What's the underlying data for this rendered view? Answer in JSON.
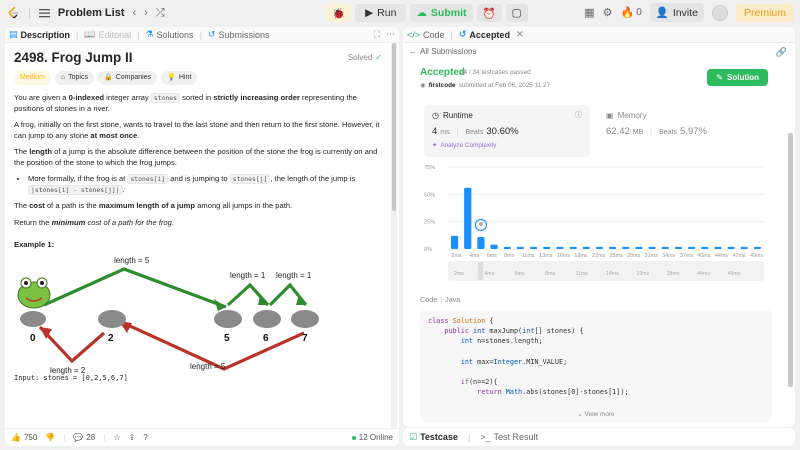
{
  "topbar": {
    "title": "Problem List",
    "run": "Run",
    "submit": "Submit",
    "likes_count": "0",
    "invite": "Invite",
    "premium": "Premium"
  },
  "left": {
    "tabs": {
      "description": "Description",
      "editorial": "Editorial",
      "solutions": "Solutions",
      "submissions": "Submissions"
    },
    "title": "2498. Frog Jump II",
    "solved": "Solved",
    "tags": {
      "difficulty": "Medium",
      "topics": "Topics",
      "companies": "Companies",
      "hint": "Hint"
    },
    "p1": {
      "a": "You are given a ",
      "b": "0-indexed",
      "c": " integer array ",
      "code": "stones",
      "d": " sorted in ",
      "e": "strictly increasing order",
      "f": " representing the positions of stones in a river."
    },
    "p2": {
      "a": "A frog, initially on the first stone, wants to travel to the last stone and then return to the first stone. However, it can jump to any stone ",
      "b": "at most once",
      "c": "."
    },
    "p3": {
      "a": "The ",
      "b": "length",
      "c": " of a jump is the absolute difference between the position of the stone the frog is currently on and the position of the stone to which the frog jumps."
    },
    "bullet": {
      "a": "More formally, if the frog is at ",
      "c1": "stones[i]",
      "b": " and is jumping to ",
      "c2": "stones[j]",
      "c": ", the length of the jump is ",
      "c3": "|stones[i] - stones[j]|",
      "d": "."
    },
    "p4": {
      "a": "The ",
      "b": "cost",
      "c": " of a path is the ",
      "d": "maximum length of a jump",
      "e": " among all jumps in the path."
    },
    "p5": {
      "a": "Return the ",
      "b": "minimum",
      "c": " cost of a path for the frog."
    },
    "example": "Example 1:",
    "diagram": {
      "labels": [
        "length = 5",
        "length = 1",
        "length = 1",
        "length = 2",
        "length = 5"
      ],
      "stones": [
        "0",
        "2",
        "5",
        "6",
        "7"
      ]
    },
    "input_line": "Input: stones = [0,2,5,6,7]",
    "footer": {
      "likes": "750",
      "comments": "28",
      "online": "12 Online"
    }
  },
  "right": {
    "tabs": {
      "code": "Code",
      "accepted": "Accepted"
    },
    "back": "All Submissions",
    "status": "Accepted",
    "passed": "34 / 34 testcases passed",
    "user": "firstcode",
    "submitted": "submitted at Feb 06, 2025 11:27",
    "solution_btn": "Solution",
    "runtime": {
      "title": "Runtime",
      "value": "4",
      "unit": "ms",
      "beats_label": "Beats",
      "beats": "30.60%",
      "analyze": "Analyze Complexity"
    },
    "memory": {
      "title": "Memory",
      "value": "62.42",
      "unit": "MB",
      "beats_label": "Beats",
      "beats": "5.97%"
    },
    "code_hdr": {
      "a": "Code",
      "b": "Java"
    },
    "code_lines": [
      "class Solution {",
      "    public int maxJump(int[] stones) {",
      "        int n=stones.length;",
      "",
      "        int max=Integer.MIN_VALUE;",
      "",
      "        if(n==2){",
      "            return Math.abs(stones[0]-stones[1]);"
    ],
    "view_more": "View more"
  },
  "bottom": {
    "testcase": "Testcase",
    "result": "Test Result"
  },
  "chart_data": {
    "type": "bar",
    "ylabels": [
      "75%",
      "50%",
      "25%",
      "0%"
    ],
    "ylim": [
      0,
      75
    ],
    "categories": [
      "2ms",
      "3ms",
      "4ms",
      "5ms",
      "6ms",
      "7ms",
      "8ms",
      "9ms",
      "10ms",
      "11ms",
      "12ms",
      "13ms",
      "14ms",
      "15ms",
      "16ms",
      "17ms",
      "18ms",
      "19ms",
      "20ms",
      "21ms",
      "22ms",
      "23ms",
      "24ms",
      "25ms",
      "26ms",
      "27ms",
      "28ms",
      "29ms",
      "30ms"
    ],
    "xlabels": [
      "2ms",
      "4ms",
      "6ms",
      "8ms",
      "11ms",
      "13ms",
      "16ms",
      "19ms",
      "22ms",
      "25ms",
      "28ms",
      "31ms",
      "34ms",
      "37ms",
      "40ms",
      "44ms",
      "47ms",
      "49ms"
    ],
    "values": [
      12,
      56,
      11,
      4,
      2,
      2,
      2,
      2,
      2,
      2,
      2,
      2,
      2,
      2,
      2,
      2,
      2,
      2,
      2,
      2,
      2,
      2,
      2,
      2
    ],
    "highlight_index": 2,
    "minimap_labels": [
      "2ms",
      "4ms",
      "6ms",
      "8ms",
      "11ms",
      "14ms",
      "19ms",
      "28ms",
      "44ms",
      "49ms"
    ],
    "bar_color": "#1a90ff"
  }
}
